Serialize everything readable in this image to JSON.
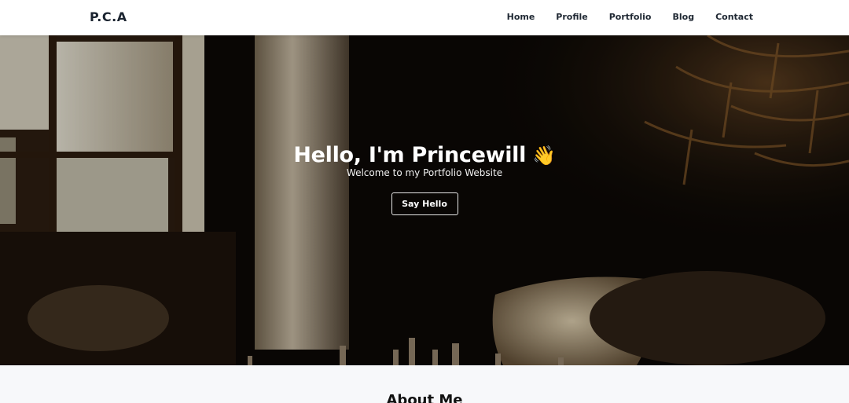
{
  "brand": {
    "name": "P.C.A"
  },
  "nav": {
    "items": [
      "Home",
      "Profile",
      "Portfolio",
      "Blog",
      "Contact"
    ]
  },
  "hero": {
    "title": "Hello, I'm Princewill",
    "title_icon": "waving-hand-icon",
    "subtitle": "Welcome to my Portfolio Website",
    "button_label": "Say Hello"
  },
  "about": {
    "title": "About Me"
  },
  "colors": {
    "nav_bg": "#ffffff",
    "nav_text": "#1f2833",
    "hero_text": "#ffffff",
    "section_bg": "#f7f8fa"
  }
}
